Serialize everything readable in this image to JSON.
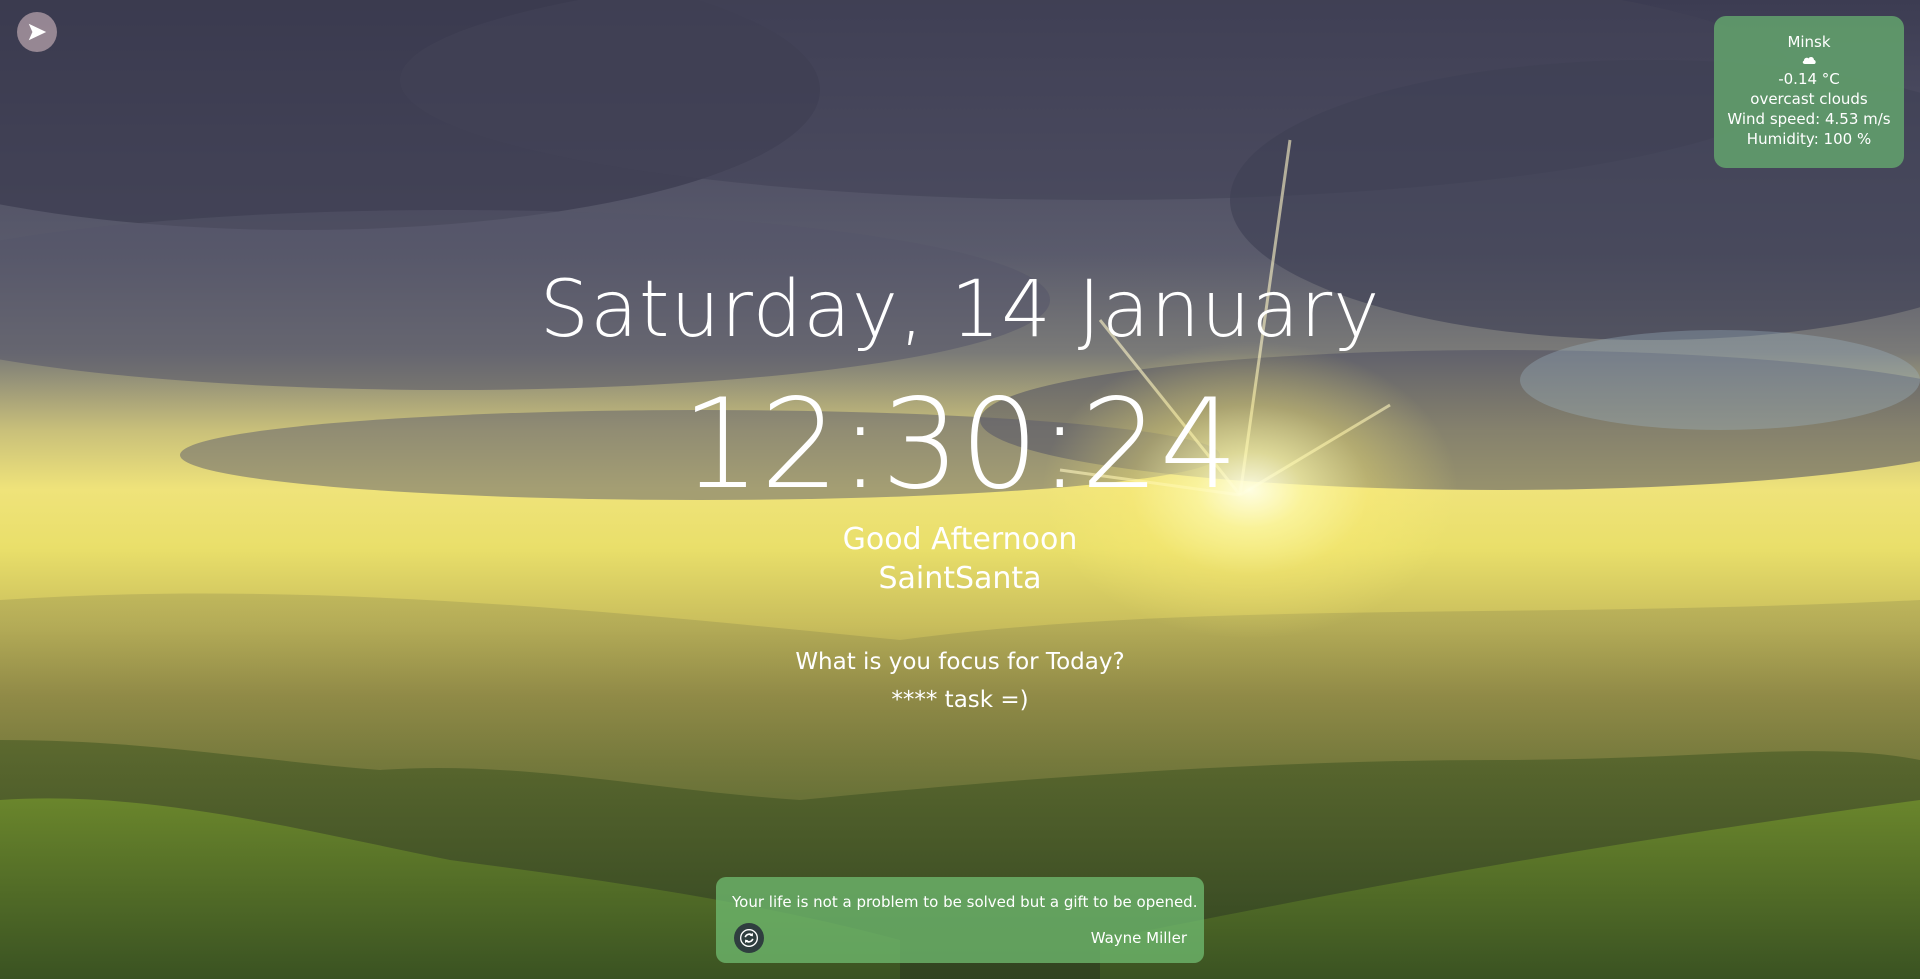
{
  "weather": {
    "city": "Minsk",
    "icon": "cloud-icon",
    "temperature": "-0.14 °C",
    "description": "overcast clouds",
    "wind": "Wind speed: 4.53 m/s",
    "humidity": "Humidity: 100 %"
  },
  "clock": {
    "date": "Saturday, 14 January",
    "time": "12:30:24"
  },
  "greeting": {
    "text": "Good Afternoon",
    "name": "SaintSanta"
  },
  "focus": {
    "question": "What is you focus for Today?",
    "value": "**** task =)"
  },
  "quote": {
    "text": "Your life is not a problem to be solved but a gift to be opened.",
    "author": "Wayne Miller"
  },
  "icons": {
    "nav": "arrow-right-icon",
    "refresh": "refresh-icon"
  },
  "colors": {
    "weather_bg": "#62a06c",
    "quote_bg": "#6eb96e",
    "refresh_bg": "#2f3e3f"
  }
}
